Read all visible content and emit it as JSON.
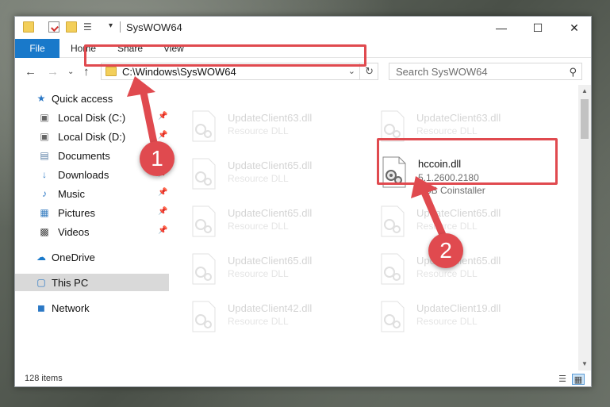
{
  "window": {
    "title": "SysWOW64",
    "minimize_icon": "minimize-icon",
    "maximize_icon": "maximize-icon",
    "close_icon": "close-icon"
  },
  "ribbon": {
    "tabs": [
      "File",
      "Home",
      "Share",
      "View"
    ]
  },
  "address": {
    "path": "C:\\Windows\\SysWOW64",
    "search_placeholder": "Search SysWOW64"
  },
  "navpane": {
    "items": [
      {
        "label": "Quick access",
        "icon": "star-icon",
        "pinned": false
      },
      {
        "label": "Local Disk (C:)",
        "icon": "drive-icon",
        "pinned": true
      },
      {
        "label": "Local Disk (D:)",
        "icon": "drive-icon",
        "pinned": true
      },
      {
        "label": "Documents",
        "icon": "documents-icon",
        "pinned": true
      },
      {
        "label": "Downloads",
        "icon": "downloads-icon",
        "pinned": true
      },
      {
        "label": "Music",
        "icon": "music-icon",
        "pinned": true
      },
      {
        "label": "Pictures",
        "icon": "pictures-icon",
        "pinned": true
      },
      {
        "label": "Videos",
        "icon": "videos-icon",
        "pinned": true
      },
      {
        "label": "OneDrive",
        "icon": "cloud-icon",
        "pinned": false
      },
      {
        "label": "This PC",
        "icon": "computer-icon",
        "pinned": false,
        "selected": true
      },
      {
        "label": "Network",
        "icon": "network-icon",
        "pinned": false
      }
    ]
  },
  "files": {
    "left": [
      {
        "name": "UpdateClient63.dll",
        "desc": "Resource DLL"
      },
      {
        "name": "UpdateClient65.dll",
        "desc": "Resource DLL"
      },
      {
        "name": "UpdateClient65.dll",
        "desc": "Resource DLL"
      },
      {
        "name": "UpdateClient65.dll",
        "desc": "Resource DLL"
      },
      {
        "name": "UpdateClient42.dll",
        "desc": "Resource DLL"
      }
    ],
    "right": [
      {
        "name": "UpdateClient63.dll",
        "desc": "Resource DLL"
      },
      {
        "name": "UpdateClient65.dll",
        "desc": "Resource DLL"
      },
      {
        "name": "UpdateClient65.dll",
        "desc": "Resource DLL"
      },
      {
        "name": "UpdateClient19.dll",
        "desc": "Resource DLL"
      }
    ],
    "highlighted": {
      "name": "hccoin.dll",
      "version": "5.1.2600.2180",
      "desc": "USB Coinstaller"
    }
  },
  "status": {
    "item_count": "128 items"
  },
  "annotations": {
    "badge1": "1",
    "badge2": "2",
    "color": "#e04a4f"
  }
}
